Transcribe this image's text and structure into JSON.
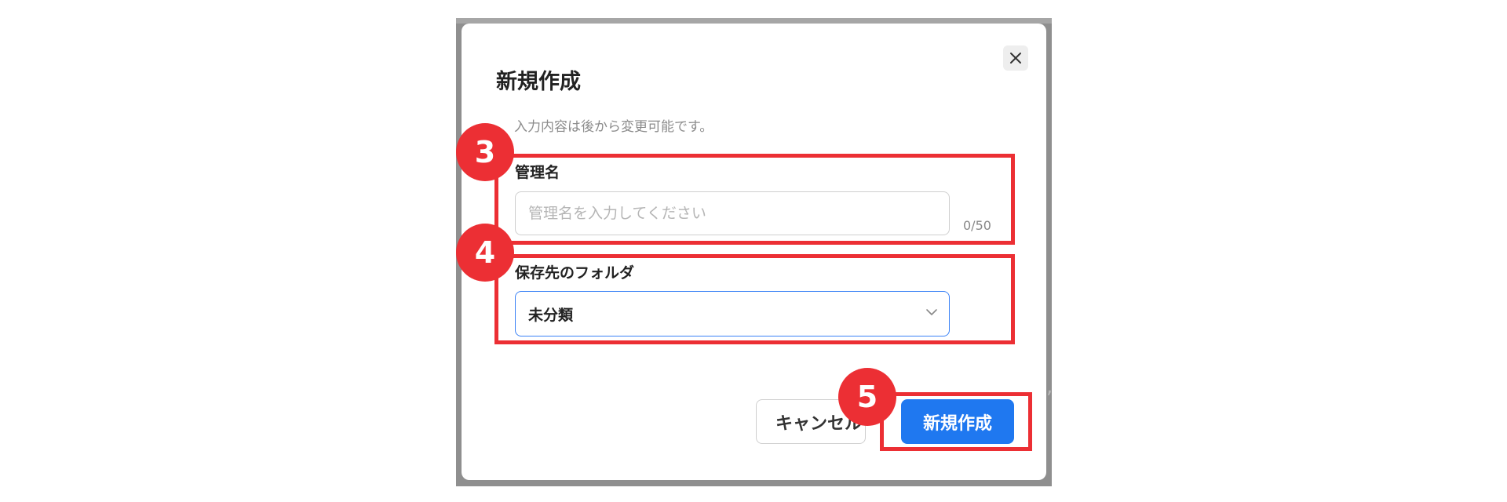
{
  "dialog": {
    "title": "新規作成",
    "description": "入力内容は後から変更可能です。",
    "close_icon": "close-icon"
  },
  "name_field": {
    "label": "管理名",
    "placeholder": "管理名を入力してください",
    "value": "",
    "counter": "0/50"
  },
  "folder_field": {
    "label": "保存先のフォルダ",
    "selected": "未分類",
    "icon": "chevron-down-icon"
  },
  "buttons": {
    "cancel": "キャンセル",
    "create": "新規作成"
  },
  "steps": [
    {
      "number": "3"
    },
    {
      "number": "4"
    },
    {
      "number": "5"
    }
  ],
  "colors": {
    "highlight": "#ec2f34",
    "primary": "#1f78f0",
    "select_border": "#3b82f6"
  }
}
